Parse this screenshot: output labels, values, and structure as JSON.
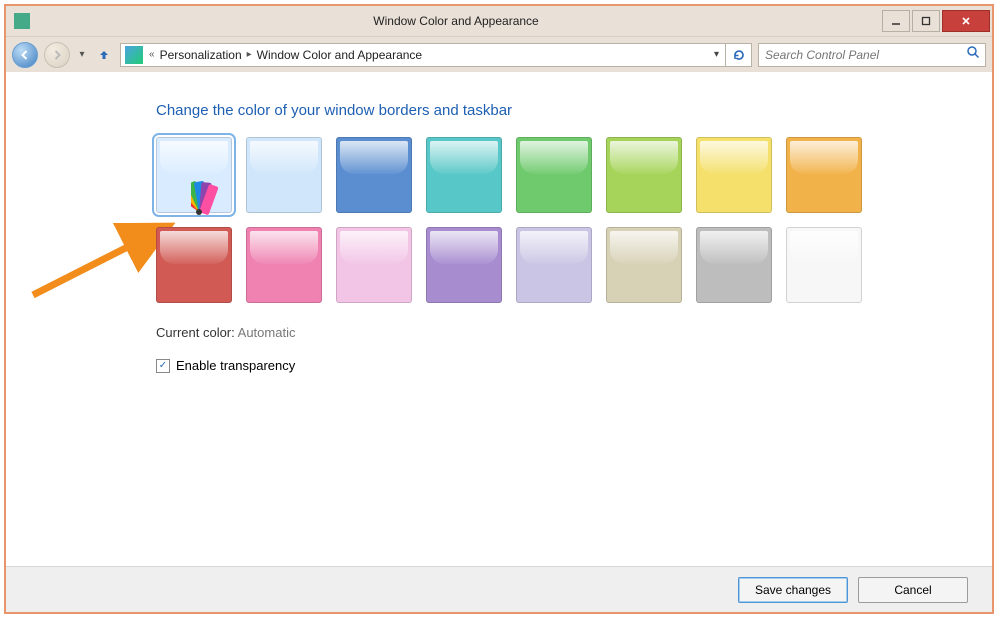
{
  "window": {
    "title": "Window Color and Appearance"
  },
  "nav": {
    "breadcrumb": [
      "Personalization",
      "Window Color and Appearance"
    ],
    "search_placeholder": "Search Control Panel"
  },
  "heading": "Change the color of your window borders and taskbar",
  "swatches": [
    {
      "name": "automatic",
      "color": "#d9ecff",
      "selected": true
    },
    {
      "name": "sky",
      "color": "#cfe6fb"
    },
    {
      "name": "blue",
      "color": "#5b8ed0"
    },
    {
      "name": "teal",
      "color": "#58c7c7"
    },
    {
      "name": "green",
      "color": "#6fca6d"
    },
    {
      "name": "lime",
      "color": "#a6d45a"
    },
    {
      "name": "yellow",
      "color": "#f4e06a"
    },
    {
      "name": "orange",
      "color": "#f2b24a"
    },
    {
      "name": "red",
      "color": "#d15a54"
    },
    {
      "name": "magenta",
      "color": "#ef82b1"
    },
    {
      "name": "pink",
      "color": "#f2c4e6"
    },
    {
      "name": "violet",
      "color": "#a78cd0"
    },
    {
      "name": "lavender",
      "color": "#cac5e4"
    },
    {
      "name": "taupe",
      "color": "#d7d1b6"
    },
    {
      "name": "gray",
      "color": "#bdbdbd"
    },
    {
      "name": "white",
      "color": "#f7f7f7"
    }
  ],
  "current_color": {
    "label": "Current color:",
    "value": "Automatic"
  },
  "transparency": {
    "label": "Enable transparency",
    "checked": true
  },
  "buttons": {
    "save": "Save changes",
    "cancel": "Cancel"
  }
}
